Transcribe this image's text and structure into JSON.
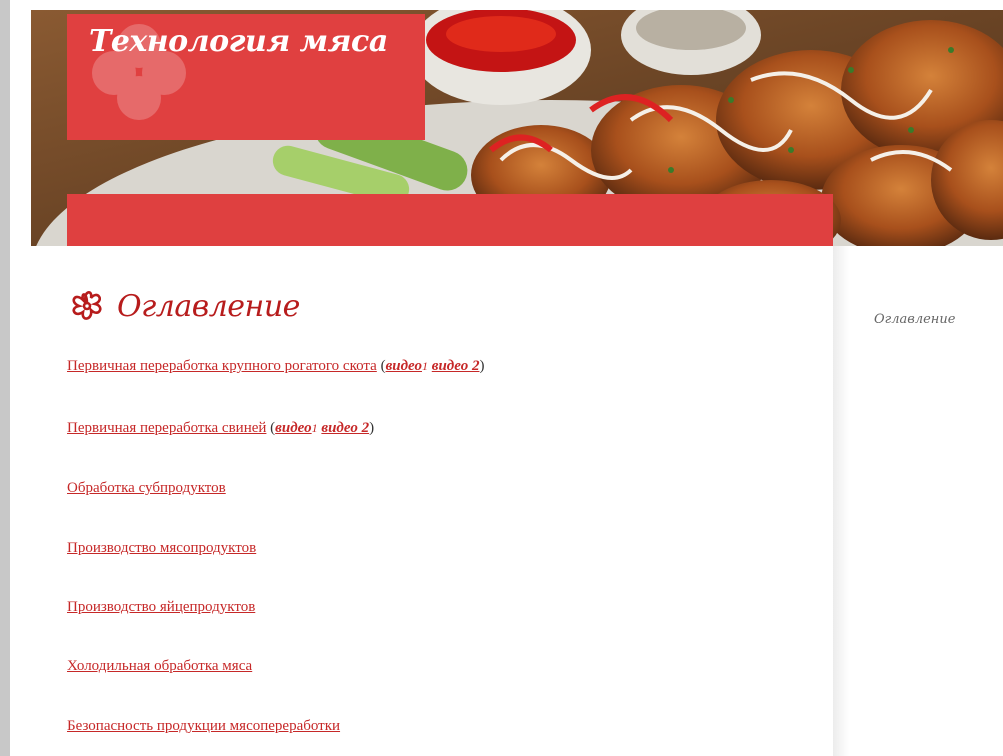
{
  "header": {
    "site_title": "Технология мяса"
  },
  "toc": {
    "title": "Оглавление",
    "items": [
      {
        "label": "Первичная переработка крупного рогатого скота",
        "open": "(",
        "video1": "видео",
        "video1_num": "1",
        "video2": "видео 2",
        "close": ")"
      },
      {
        "label": "Первичная переработка свиней",
        "open": "(",
        "video1": "видео",
        "video1_num": "1",
        "video2": "видео 2",
        "close": ")"
      },
      {
        "label": "Обработка субпродуктов"
      },
      {
        "label": "Производство мясопродуктов"
      },
      {
        "label": "Производство яйцепродуктов"
      },
      {
        "label": "Холодильная обработка мяса"
      },
      {
        "label": "Безопасность продукции мясопереработки"
      }
    ]
  },
  "sidebar": {
    "label": "Оглавление"
  },
  "colors": {
    "accent": "#e04040",
    "title_red": "#b71c1c",
    "link_red": "#c62828"
  }
}
